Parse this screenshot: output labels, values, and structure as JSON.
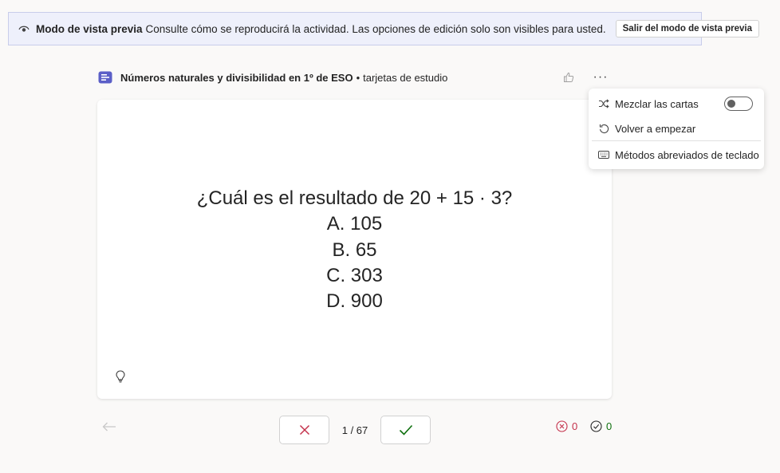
{
  "banner": {
    "icon": "eye-icon",
    "title": "Modo de vista previa",
    "description": "Consulte cómo se reproducirá la actividad. Las opciones de edición solo son visibles para usted.",
    "exit_label": "Salir del modo de vista previa"
  },
  "header": {
    "activity_title": "Números naturales y divisibilidad en 1º de ESO",
    "separator": "•",
    "activity_type": "tarjetas de estudio",
    "more_label": "···",
    "accent_color": "#5b5fc7"
  },
  "card": {
    "question_lines": [
      "¿Cuál es el resultado de 20 + 15 · 3?",
      "A. 105",
      "B. 65",
      "C. 303",
      "D. 900"
    ]
  },
  "menu": {
    "shuffle_label": "Mezclar las cartas",
    "shuffle_on": false,
    "restart_label": "Volver a empezar",
    "shortcuts_label": "Métodos abreviados de teclado"
  },
  "footer": {
    "counter": "1 / 67",
    "incorrect_count": "0",
    "correct_count": "0",
    "incorrect_color": "#c4314b",
    "correct_color": "#0e700e"
  }
}
